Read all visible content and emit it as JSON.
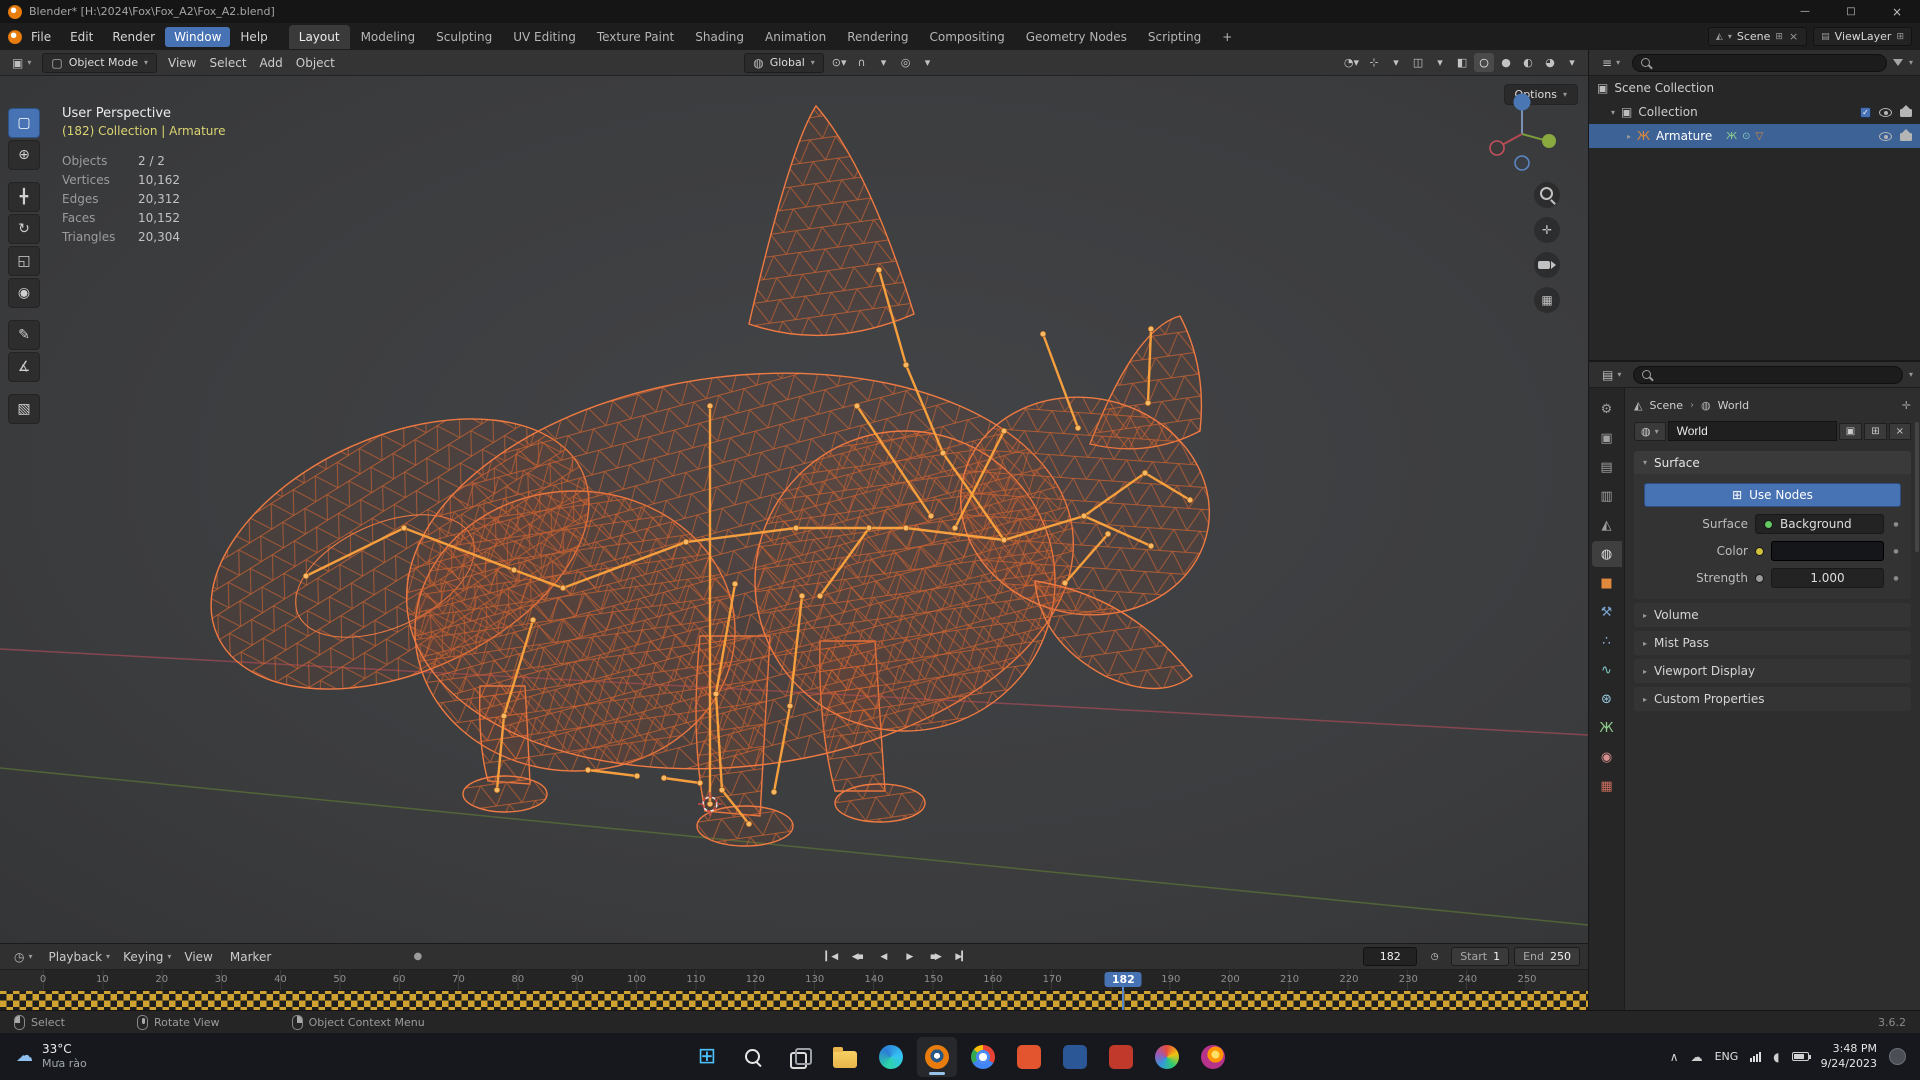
{
  "icons": {
    "caret": "▾",
    "collapsed": "▸",
    "expanded": "▾",
    "close": "×",
    "breadcrumb_sep": "›",
    "scene": "◭",
    "world": "◍",
    "collection": "▣",
    "armature": "Ж",
    "editor_3d": "▣",
    "editor_timeline": "◷",
    "editor_outliner": "≡",
    "editor_props": "▤",
    "mode_object": "▢",
    "orientation_globe": "◍",
    "clock": "◷",
    "record": "●",
    "nodes": "⊞",
    "copy": "▣",
    "pin": "✛",
    "cloud": "☁",
    "weather": "☁",
    "start_glyph": "⊞",
    "volume": "◖"
  },
  "titlebar": {
    "title": "Blender* [H:\\2024\\Fox\\Fox_A2\\Fox_A2.blend]",
    "controls": [
      {
        "name": "minimize-button",
        "glyph": "—"
      },
      {
        "name": "maximize-button",
        "glyph": "□"
      },
      {
        "name": "close-button",
        "glyph": "×"
      }
    ]
  },
  "menubar": {
    "menus": [
      {
        "label": "File"
      },
      {
        "label": "Edit"
      },
      {
        "label": "Render"
      },
      {
        "label": "Window",
        "active": true
      },
      {
        "label": "Help"
      }
    ],
    "workspaces": [
      {
        "label": "Layout",
        "active": true
      },
      {
        "label": "Modeling"
      },
      {
        "label": "Sculpting"
      },
      {
        "label": "UV Editing"
      },
      {
        "label": "Texture Paint"
      },
      {
        "label": "Shading"
      },
      {
        "label": "Animation"
      },
      {
        "label": "Rendering"
      },
      {
        "label": "Compositing"
      },
      {
        "label": "Geometry Nodes"
      },
      {
        "label": "Scripting"
      },
      {
        "label": "+"
      }
    ],
    "scene_label": "Scene",
    "viewlayer_label": "ViewLayer"
  },
  "viewport_header": {
    "mode_label": "Object Mode",
    "menus": [
      {
        "label": "View"
      },
      {
        "label": "Select"
      },
      {
        "label": "Add"
      },
      {
        "label": "Object"
      }
    ],
    "orientation_label": "Global",
    "mid_buttons": [
      {
        "name": "pivot-point-dropdown",
        "glyph": "⊙▾"
      },
      {
        "name": "snap-magnet-toggle",
        "glyph": "∩"
      },
      {
        "name": "snap-settings-dropdown",
        "glyph": "▾"
      },
      {
        "name": "proportional-editing-toggle",
        "glyph": "◎"
      },
      {
        "name": "proportional-falloff-dropdown",
        "glyph": "▾"
      }
    ],
    "right_buttons": [
      {
        "name": "object-visibility-dropdown",
        "glyph": "◔▾"
      },
      {
        "name": "show-gizmos-toggle",
        "glyph": "⊹"
      },
      {
        "name": "gizmos-dropdown",
        "glyph": "▾"
      },
      {
        "name": "show-overlays-toggle",
        "glyph": "◫"
      },
      {
        "name": "overlays-dropdown",
        "glyph": "▾"
      },
      {
        "name": "toggle-xray-button",
        "glyph": "◧"
      },
      {
        "name": "shading-wireframe-button",
        "glyph": "○",
        "active": true
      },
      {
        "name": "shading-solid-button",
        "glyph": "●"
      },
      {
        "name": "shading-material-button",
        "glyph": "◐"
      },
      {
        "name": "shading-rendered-button",
        "glyph": "◕"
      },
      {
        "name": "shading-dropdown",
        "glyph": "▾"
      }
    ],
    "options_label": "Options"
  },
  "tools": [
    {
      "name": "tool-select-box",
      "glyph": "▢",
      "active": true
    },
    {
      "name": "tool-cursor",
      "glyph": "⊕"
    },
    {
      "name": "tool-move",
      "glyph": "╋",
      "cls": "grp"
    },
    {
      "name": "tool-rotate",
      "glyph": "↻"
    },
    {
      "name": "tool-scale",
      "glyph": "◱"
    },
    {
      "name": "tool-transform",
      "glyph": "◉"
    },
    {
      "name": "tool-annotate",
      "glyph": "✎",
      "cls": "grp"
    },
    {
      "name": "tool-measure",
      "glyph": "∡"
    },
    {
      "name": "tool-add-cube",
      "glyph": "▧",
      "cls": "grp"
    }
  ],
  "viewport": {
    "view_label": "User Perspective",
    "context_label": "(182) Collection | Armature",
    "stats": [
      {
        "k": "Objects",
        "v": "2 / 2"
      },
      {
        "k": "Vertices",
        "v": "10,162"
      },
      {
        "k": "Edges",
        "v": "20,312"
      },
      {
        "k": "Faces",
        "v": "10,152"
      },
      {
        "k": "Triangles",
        "v": "20,304"
      }
    ],
    "nav_buttons": [
      {
        "name": "zoom-icon",
        "cls": "nav-mag",
        "glyph": ""
      },
      {
        "name": "pan-hand-icon",
        "glyph": "✛"
      },
      {
        "name": "camera-view-icon",
        "cls": "nav-cam",
        "glyph": ""
      },
      {
        "name": "toggle-ortho-icon",
        "glyph": "▦"
      }
    ]
  },
  "outliner": {
    "scene_collection": "Scene Collection",
    "collection": "Collection",
    "armature": "Armature",
    "armature_badges": [
      {
        "name": "armature-data-icon",
        "glyph": "Ж",
        "color": "#8fce8f"
      },
      {
        "name": "pose-icon",
        "glyph": "⊙",
        "color": "#7fc8c4"
      },
      {
        "name": "modifier-icon",
        "glyph": "▽",
        "color": "#e0883c"
      }
    ]
  },
  "properties": {
    "breadcrumb": [
      {
        "label": "Scene",
        "icon": "◭"
      },
      {
        "label": "World",
        "icon": "◍"
      }
    ],
    "datablock_name": "World",
    "surface_panel": {
      "title": "Surface",
      "use_nodes_label": "Use Nodes",
      "surface_label": "Surface",
      "surface_value": "Background",
      "color_label": "Color",
      "strength_label": "Strength",
      "strength_value": "1.000"
    },
    "closed_panels": [
      {
        "name": "panel-volume",
        "label": "Volume",
        "caret": "▸"
      },
      {
        "name": "panel-mist-pass",
        "label": "Mist Pass",
        "caret": "▸"
      },
      {
        "name": "panel-viewport-display",
        "label": "Viewport Display",
        "caret": "▸"
      },
      {
        "name": "panel-custom-properties",
        "label": "Custom Properties",
        "caret": "▸"
      }
    ],
    "tabs": [
      {
        "name": "tab-tool",
        "glyph": "⚙",
        "color": "#a0a0a0"
      },
      {
        "name": "tab-render",
        "glyph": "▣",
        "color": "#a0a0a0"
      },
      {
        "name": "tab-output",
        "glyph": "▤",
        "color": "#a0a0a0"
      },
      {
        "name": "tab-view-layer",
        "glyph": "▥",
        "color": "#a0a0a0"
      },
      {
        "name": "tab-scene",
        "glyph": "◭",
        "color": "#a0a0a0"
      },
      {
        "name": "tab-world",
        "glyph": "◍",
        "color": "#e0e0e0",
        "active": true
      },
      {
        "name": "tab-object",
        "glyph": "■",
        "color": "#e0883c"
      },
      {
        "name": "tab-modifiers",
        "glyph": "⚒",
        "color": "#7aa2cf"
      },
      {
        "name": "tab-particles",
        "glyph": "∴",
        "color": "#8fb4d8"
      },
      {
        "name": "tab-physics",
        "glyph": "∿",
        "color": "#7fc8c4"
      },
      {
        "name": "tab-constraints",
        "glyph": "⊛",
        "color": "#9fd0e8"
      },
      {
        "name": "tab-data",
        "glyph": "Ж",
        "color": "#8fce8f"
      },
      {
        "name": "tab-material",
        "glyph": "◉",
        "color": "#d88f8f"
      },
      {
        "name": "tab-texture",
        "glyph": "▦",
        "color": "#cf6f5f"
      }
    ]
  },
  "timeline": {
    "menus": [
      {
        "label": "Playback",
        "caret": "▾"
      },
      {
        "label": "Keying",
        "caret": "▾"
      },
      {
        "label": "View",
        "caret": ""
      },
      {
        "label": "Marker",
        "caret": ""
      }
    ],
    "transport": [
      {
        "name": "jump-to-start-button",
        "glyph": "▎◀"
      },
      {
        "name": "prev-keyframe-button",
        "glyph": "◀▪"
      },
      {
        "name": "play-reverse-button",
        "glyph": "◀"
      },
      {
        "name": "play-button",
        "glyph": "▶"
      },
      {
        "name": "next-keyframe-button",
        "glyph": "▪▶"
      },
      {
        "name": "jump-to-end-button",
        "glyph": "▶▎"
      }
    ],
    "frame_field": "182",
    "start_label": "Start",
    "start_value": "1",
    "end_label": "End",
    "end_value": "250",
    "playhead": {
      "label": "182",
      "pct": 72.8
    },
    "ticks": [
      {
        "label": "0",
        "pct": 0
      },
      {
        "label": "10",
        "pct": 4
      },
      {
        "label": "20",
        "pct": 8
      },
      {
        "label": "30",
        "pct": 12
      },
      {
        "label": "40",
        "pct": 16
      },
      {
        "label": "50",
        "pct": 20
      },
      {
        "label": "60",
        "pct": 24
      },
      {
        "label": "70",
        "pct": 28
      },
      {
        "label": "80",
        "pct": 32
      },
      {
        "label": "90",
        "pct": 36
      },
      {
        "label": "100",
        "pct": 40
      },
      {
        "label": "110",
        "pct": 44
      },
      {
        "label": "120",
        "pct": 48
      },
      {
        "label": "130",
        "pct": 52
      },
      {
        "label": "140",
        "pct": 56
      },
      {
        "label": "150",
        "pct": 60
      },
      {
        "label": "160",
        "pct": 64
      },
      {
        "label": "170",
        "pct": 68
      },
      {
        "label": "190",
        "pct": 76
      },
      {
        "label": "200",
        "pct": 80
      },
      {
        "label": "210",
        "pct": 84
      },
      {
        "label": "220",
        "pct": 88
      },
      {
        "label": "230",
        "pct": 92
      },
      {
        "label": "240",
        "pct": 96
      },
      {
        "label": "250",
        "pct": 100
      }
    ]
  },
  "statusbar": {
    "items": [
      {
        "name": "mouse-left-hint",
        "cls": "m-left",
        "label": "Select"
      },
      {
        "name": "mouse-middle-hint",
        "cls": "m-mid",
        "label": "Rotate View"
      },
      {
        "name": "mouse-right-hint",
        "cls": "m-right",
        "label": "Object Context Menu"
      }
    ],
    "version": "3.6.2"
  },
  "taskbar": {
    "weather": {
      "temp": "33°C",
      "desc": "Mưa rào"
    },
    "apps": [
      {
        "name": "start-button",
        "cls": "ic-start",
        "glyph": "⊞"
      },
      {
        "name": "search-button",
        "cls": "ic-search",
        "glyph": ""
      },
      {
        "name": "task-view-button",
        "cls": "ic-task",
        "glyph": ""
      },
      {
        "name": "file-explorer-icon",
        "cls": "ic-folder",
        "glyph": ""
      },
      {
        "name": "edge-icon",
        "cls": "ic-edge",
        "glyph": ""
      },
      {
        "name": "blender-icon",
        "cls": "ic-blender",
        "glyph": "",
        "active": true
      },
      {
        "name": "chrome-icon",
        "cls": "ic-chrome",
        "glyph": ""
      },
      {
        "name": "app-icon-orange",
        "cls": "ic-or",
        "glyph": ""
      },
      {
        "name": "app-icon-blue",
        "cls": "ic-bl",
        "glyph": ""
      },
      {
        "name": "app-icon-red",
        "cls": "ic-rd",
        "glyph": ""
      },
      {
        "name": "app-icon-multicolor",
        "cls": "ic-mc",
        "glyph": ""
      },
      {
        "name": "firefox-icon",
        "cls": "ic-ff",
        "glyph": ""
      }
    ],
    "tray": {
      "chevron": "∧",
      "lang": "ENG",
      "time": "3:48 PM",
      "date": "9/24/2023"
    }
  }
}
